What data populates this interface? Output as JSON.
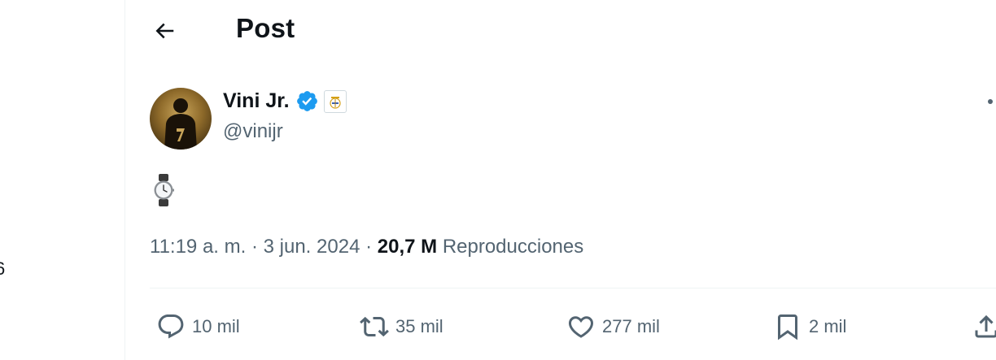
{
  "header": {
    "back_label": "←",
    "title": "Post"
  },
  "left_edge": {
    "glyph": "6"
  },
  "post": {
    "author": {
      "display_name": "Vini Jr.",
      "handle": "@vinijr",
      "verified": true,
      "affiliation_badge": "real-madrid-crest-icon"
    },
    "text": "⌚",
    "meta": {
      "time": "11:19 a. m.",
      "separator": "·",
      "date": "3 jun. 2024",
      "views_count": "20,7 M",
      "views_label": "Reproducciones"
    },
    "actions": {
      "replies": "10 mil",
      "reposts": "35 mil",
      "likes": "277 mil",
      "bookmarks": "2 mil"
    }
  },
  "colors": {
    "accent": "#1d9bf0",
    "secondary_text": "#536471",
    "primary_text": "#0f1419",
    "divider": "#eff3f4"
  }
}
